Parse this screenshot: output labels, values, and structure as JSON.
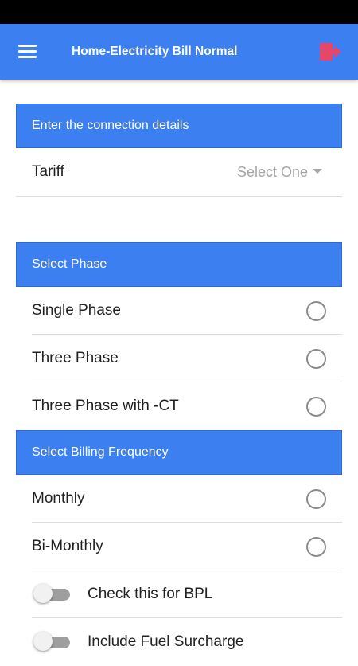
{
  "app_bar": {
    "title": "Home-Electricity Bill Normal",
    "menu_icon": "hamburger-menu-icon",
    "logout_icon": "logout-icon",
    "logout_icon_color": "#e8456a",
    "background_color": "#3b7ff0"
  },
  "connection": {
    "header": "Enter the connection details",
    "tariff_label": "Tariff",
    "tariff_value": "Select One"
  },
  "phase": {
    "header": "Select Phase",
    "options": [
      {
        "label": "Single Phase",
        "selected": false
      },
      {
        "label": "Three Phase",
        "selected": false
      },
      {
        "label": "Three Phase with -CT",
        "selected": false
      }
    ]
  },
  "billing": {
    "header": "Select Billing Frequency",
    "options": [
      {
        "label": "Monthly",
        "selected": false
      },
      {
        "label": "Bi-Monthly",
        "selected": false
      }
    ]
  },
  "toggles": [
    {
      "label": "Check this for BPL",
      "on": false
    },
    {
      "label": "Include Fuel Surcharge",
      "on": false
    }
  ]
}
